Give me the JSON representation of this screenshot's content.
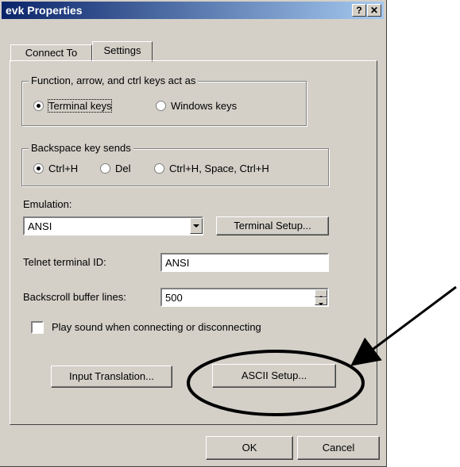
{
  "window": {
    "title": "evk Properties",
    "help_glyph": "?",
    "close_glyph": "✕"
  },
  "tabs": [
    {
      "label": "Connect To"
    },
    {
      "label": "Settings"
    }
  ],
  "function_keys_group": {
    "legend": "Function, arrow, and ctrl keys act as",
    "options": [
      {
        "label": "Terminal keys",
        "selected": true
      },
      {
        "label": "Windows keys",
        "selected": false
      }
    ]
  },
  "backspace_group": {
    "legend": "Backspace key sends",
    "options": [
      {
        "label": "Ctrl+H",
        "selected": true
      },
      {
        "label": "Del",
        "selected": false
      },
      {
        "label": "Ctrl+H, Space, Ctrl+H",
        "selected": false
      }
    ]
  },
  "emulation": {
    "label": "Emulation:",
    "value": "ANSI",
    "setup_button": "Terminal Setup..."
  },
  "telnet_id": {
    "label": "Telnet terminal ID:",
    "value": "ANSI"
  },
  "backscroll": {
    "label": "Backscroll buffer lines:",
    "value": "500"
  },
  "play_sound": {
    "label": "Play sound when connecting or disconnecting",
    "checked": false
  },
  "buttons": {
    "input_translation": "Input Translation...",
    "ascii_setup": "ASCII Setup...",
    "ok": "OK",
    "cancel": "Cancel"
  },
  "colors": {
    "title_start": "#0a246a",
    "title_end": "#a6caf0",
    "dialog_bg": "#d4d0c8",
    "annotation": "#000000"
  }
}
